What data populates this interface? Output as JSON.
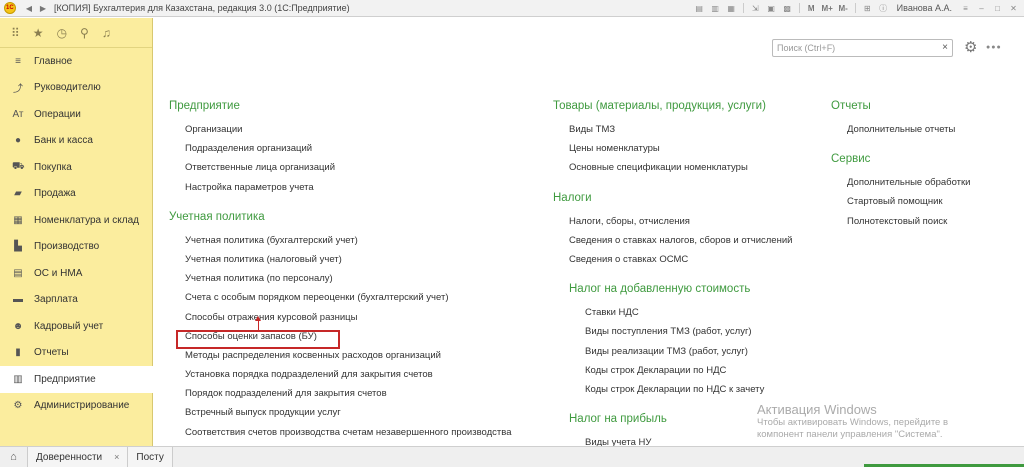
{
  "titlebar": {
    "title": "[КОПИЯ] Бухгалтерия для Казахстана, редакция 3.0  (1С:Предприятие)",
    "m1": "M",
    "m2": "M+",
    "m3": "M-",
    "user": "Иванова А.А."
  },
  "sidebar": {
    "items": [
      {
        "label": "Главное",
        "icon": "menu-icon"
      },
      {
        "label": "Руководителю",
        "icon": "chart-icon"
      },
      {
        "label": "Операции",
        "icon": "operations-icon"
      },
      {
        "label": "Банк и касса",
        "icon": "bank-icon"
      },
      {
        "label": "Покупка",
        "icon": "cart-icon"
      },
      {
        "label": "Продажа",
        "icon": "sale-icon"
      },
      {
        "label": "Номенклатура и склад",
        "icon": "warehouse-icon"
      },
      {
        "label": "Производство",
        "icon": "factory-icon"
      },
      {
        "label": "ОС и НМА",
        "icon": "assets-icon"
      },
      {
        "label": "Зарплата",
        "icon": "salary-icon"
      },
      {
        "label": "Кадровый учет",
        "icon": "people-icon"
      },
      {
        "label": "Отчеты",
        "icon": "reports-icon"
      },
      {
        "label": "Предприятие",
        "icon": "enterprise-icon",
        "active": true
      },
      {
        "label": "Администрирование",
        "icon": "admin-gear-icon"
      }
    ]
  },
  "search": {
    "placeholder": "Поиск (Ctrl+F)",
    "value": ""
  },
  "sections": {
    "enterprise": {
      "title": "Предприятие",
      "links": [
        "Организации",
        "Подразделения организаций",
        "Ответственные лица организаций",
        "Настройка параметров учета"
      ]
    },
    "policy": {
      "title": "Учетная политика",
      "links": [
        "Учетная политика (бухгалтерский учет)",
        "Учетная политика (налоговый учет)",
        "Учетная политика (по персоналу)",
        "Счета с особым порядком переоценки (бухгалтерский учет)",
        "Способы отражения курсовой разницы",
        "Способы оценки запасов (БУ)",
        "Методы распределения косвенных расходов организаций",
        "Установка порядка подразделений для закрытия счетов",
        "Порядок подразделений для закрытия счетов",
        "Встречный выпуск продукции услуг",
        "Соответствия счетов производства счетам незавершенного производства"
      ]
    },
    "goods": {
      "title": "Товары (материалы, продукция, услуги)",
      "links": [
        "Виды ТМЗ",
        "Цены номенклатуры",
        "Основные спецификации номенклатуры"
      ]
    },
    "taxes": {
      "title": "Налоги",
      "links": [
        "Налоги, сборы, отчисления",
        "Сведения о ставках налогов, сборов и отчислений",
        "Сведения о ставках ОСМС"
      ]
    },
    "vat": {
      "title": "Налог на добавленную стоимость",
      "links": [
        "Ставки НДС",
        "Виды поступления ТМЗ (работ, услуг)",
        "Виды реализации ТМЗ (работ, услуг)",
        "Коды строк Декларации по НДС",
        "Коды строк Декларации по НДС к зачету"
      ]
    },
    "profit": {
      "title": "Налог на прибыль",
      "links": [
        "Виды учета НУ"
      ]
    },
    "reports": {
      "title": "Отчеты",
      "links": [
        "Дополнительные отчеты"
      ]
    },
    "service": {
      "title": "Сервис",
      "links": [
        "Дополнительные обработки",
        "Стартовый помощник",
        "Полнотекстовый поиск"
      ]
    }
  },
  "activation": {
    "title": "Активация Windows",
    "line1": "Чтобы активировать Windows, перейдите в",
    "line2": "компонент панели управления \"Система\"."
  },
  "bottom_tabs": [
    {
      "label": "Доверенности"
    },
    {
      "label": "Посту"
    }
  ],
  "colors": {
    "accent_green": "#3f9a3f",
    "sidebar_bg": "#fbed9e",
    "highlight_red": "#c62828"
  }
}
